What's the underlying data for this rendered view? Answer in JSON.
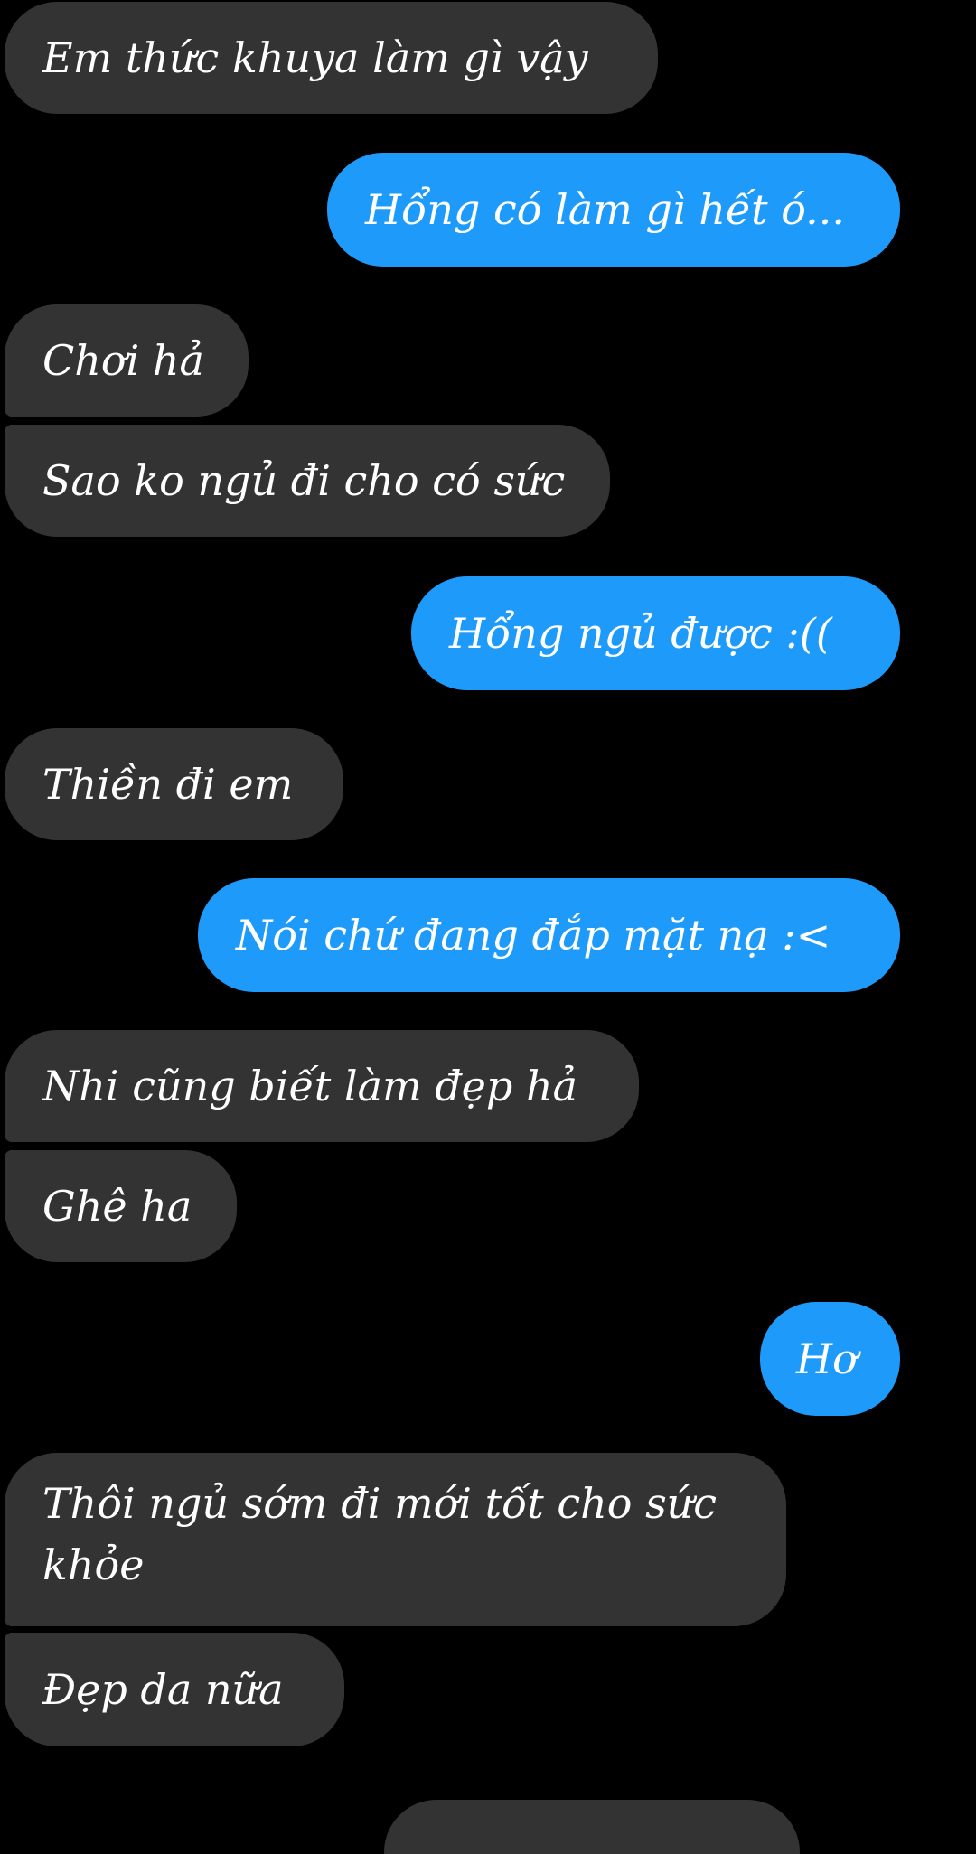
{
  "conversation": {
    "messages": [
      {
        "sender": "contact",
        "text": "Em thức khuya làm gì vậy"
      },
      {
        "sender": "me",
        "text": "Hổng có làm gì hết ó..."
      },
      {
        "sender": "contact",
        "text": "Chơi hả"
      },
      {
        "sender": "contact",
        "text": "Sao ko ngủ đi cho có sức"
      },
      {
        "sender": "me",
        "text": "Hổng ngủ được :(("
      },
      {
        "sender": "contact",
        "text": "Thiền đi em"
      },
      {
        "sender": "me",
        "text": "Nói chứ đang đắp mặt nạ :<"
      },
      {
        "sender": "contact",
        "text": "Nhi cũng biết làm đẹp hả"
      },
      {
        "sender": "contact",
        "text": "Ghê ha"
      },
      {
        "sender": "me",
        "text": "Hơ"
      },
      {
        "sender": "contact",
        "text": "Thôi ngủ sớm đi mới tốt cho sức khỏe"
      },
      {
        "sender": "contact",
        "text": "Đẹp da nữa"
      }
    ]
  },
  "colors": {
    "background": "#000000",
    "incoming_bubble": "#333333",
    "outgoing_bubble": "#1e9bfa",
    "text": "#ffffff"
  }
}
